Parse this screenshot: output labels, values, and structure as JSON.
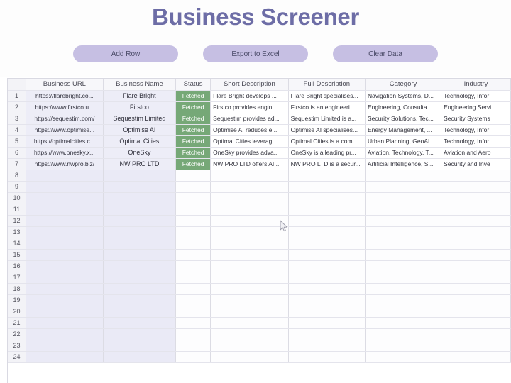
{
  "header": {
    "title": "Business Screener"
  },
  "toolbar": {
    "add_row_label": "Add Row",
    "export_excel_label": "Export to Excel",
    "clear_data_label": "Clear Data"
  },
  "sheet": {
    "corner_label": "",
    "columns": [
      "Business URL",
      "Business Name",
      "Status",
      "Short Description",
      "Full Description",
      "Category",
      "Industry"
    ],
    "status_color": "#76a877",
    "filled_cell_color": "#ededf7",
    "rows": [
      {
        "num": "1",
        "url": "https://flarebright.co...",
        "name": "Flare Bright",
        "status": "Fetched",
        "short": "Flare Bright develops ...",
        "full": "Flare Bright specialises...",
        "category": "Navigation Systems, D...",
        "industry": "Technology, Infor"
      },
      {
        "num": "2",
        "url": "https://www.firstco.u...",
        "name": "Firstco",
        "status": "Fetched",
        "short": "Firstco provides engin...",
        "full": "Firstco is an engineeri...",
        "category": "Engineering, Consulta...",
        "industry": "Engineering Servi"
      },
      {
        "num": "3",
        "url": "https://sequestim.com/",
        "name": "Sequestim Limited",
        "status": "Fetched",
        "short": "Sequestim provides ad...",
        "full": "Sequestim Limited is a...",
        "category": "Security Solutions, Tec...",
        "industry": "Security Systems"
      },
      {
        "num": "4",
        "url": "https://www.optimise...",
        "name": "Optimise AI",
        "status": "Fetched",
        "short": "Optimise AI reduces e...",
        "full": "Optimise AI specialises...",
        "category": "Energy Management, ...",
        "industry": "Technology, Infor"
      },
      {
        "num": "5",
        "url": "https://optimalcities.c...",
        "name": "Optimal Cities",
        "status": "Fetched",
        "short": "Optimal Cities leverag...",
        "full": "Optimal Cities is a com...",
        "category": "Urban Planning, GeoAI...",
        "industry": "Technology, Infor"
      },
      {
        "num": "6",
        "url": "https://www.onesky.x...",
        "name": "OneSky",
        "status": "Fetched",
        "short": "OneSky provides adva...",
        "full": "OneSky is a leading pr...",
        "category": "Aviation, Technology, T...",
        "industry": "Aviation and Aero"
      },
      {
        "num": "7",
        "url": "https://www.nwpro.biz/",
        "name": "NW PRO LTD",
        "status": "Fetched",
        "short": "NW PRO LTD offers AI...",
        "full": "NW PRO LTD is a secur...",
        "category": "Artificial Intelligence, S...",
        "industry": "Security and Inve"
      }
    ],
    "empty_row_numbers": [
      "8",
      "9",
      "10",
      "11",
      "12",
      "13",
      "14",
      "15",
      "16",
      "17",
      "18",
      "19",
      "20",
      "21",
      "22",
      "23",
      "24"
    ]
  }
}
